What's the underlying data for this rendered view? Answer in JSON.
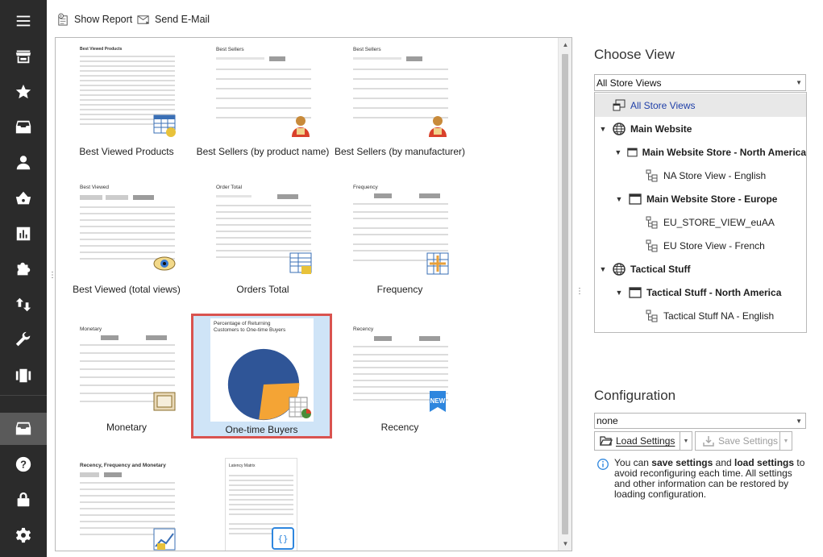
{
  "toolbar": {
    "show_report_label": "Show Report",
    "send_email_label": "Send E-Mail"
  },
  "nav": {
    "icons": [
      "menu-icon",
      "store-icon",
      "star-icon",
      "archive-icon",
      "customer-icon",
      "basket-icon",
      "report-icon",
      "puzzle-icon",
      "sync-icon",
      "wrench-icon",
      "carousel-icon",
      "inbox-icon",
      "help-icon",
      "lock-icon",
      "settings-icon"
    ],
    "active": "inbox-icon"
  },
  "gallery": {
    "tiles": [
      {
        "label": "Best Viewed Products",
        "thumb_title": "Best Viewed Products"
      },
      {
        "label": "Best Sellers (by product name)",
        "thumb_title": "Best Sellers"
      },
      {
        "label": "Best Sellers (by manufacturer)",
        "thumb_title": "Best Sellers"
      },
      {
        "label": "Best Viewed (total views)",
        "thumb_title": "Best Viewed"
      },
      {
        "label": "Orders Total",
        "thumb_title": "Order Total"
      },
      {
        "label": "Frequency",
        "thumb_title": "Frequency"
      },
      {
        "label": "Monetary",
        "thumb_title": "Monetary"
      },
      {
        "label": "One-time Buyers",
        "thumb_title": "Percentage of Returning Customers to One-time Buyers",
        "selected": true
      },
      {
        "label": "Recency",
        "thumb_title": "Recency"
      },
      {
        "label": "",
        "thumb_title": "Recency, Frequency and Monetary"
      },
      {
        "label": "",
        "thumb_title": "Latency Matrix"
      }
    ]
  },
  "choose_view": {
    "title": "Choose View",
    "combo_value": "All Store Views",
    "tree": [
      {
        "label": "All Store Views",
        "level": 0,
        "icon": "store-views-icon",
        "selected": true,
        "link": true
      },
      {
        "label": "Main Website",
        "level": 0,
        "icon": "globe-icon",
        "expanded": true,
        "bold": true
      },
      {
        "label": "Main Website Store - North America",
        "level": 1,
        "icon": "store-window-icon",
        "expanded": true,
        "bold": true
      },
      {
        "label": "NA Store View - English",
        "level": 2,
        "icon": "tree-view-icon"
      },
      {
        "label": "Main Website Store - Europe",
        "level": 1,
        "icon": "store-window-icon",
        "expanded": true,
        "bold": true
      },
      {
        "label": "EU_STORE_VIEW_euAA",
        "level": 2,
        "icon": "tree-view-icon"
      },
      {
        "label": "EU Store View - French",
        "level": 2,
        "icon": "tree-view-icon"
      },
      {
        "label": "Tactical Stuff",
        "level": 0,
        "icon": "globe-icon",
        "expanded": true,
        "bold": true
      },
      {
        "label": "Tactical Stuff - North America",
        "level": 1,
        "icon": "store-window-icon",
        "expanded": true,
        "bold": true
      },
      {
        "label": "Tactical Stuff NA - English",
        "level": 2,
        "icon": "tree-view-icon"
      }
    ]
  },
  "configuration": {
    "title": "Configuration",
    "combo_value": "none",
    "load_label": "Load Settings",
    "save_label": "Save Settings",
    "info_parts": [
      "You can ",
      "save settings",
      " and ",
      "load settings",
      " to avoid reconfiguring each time. All settings and other information can be restored by loading configuration."
    ]
  }
}
